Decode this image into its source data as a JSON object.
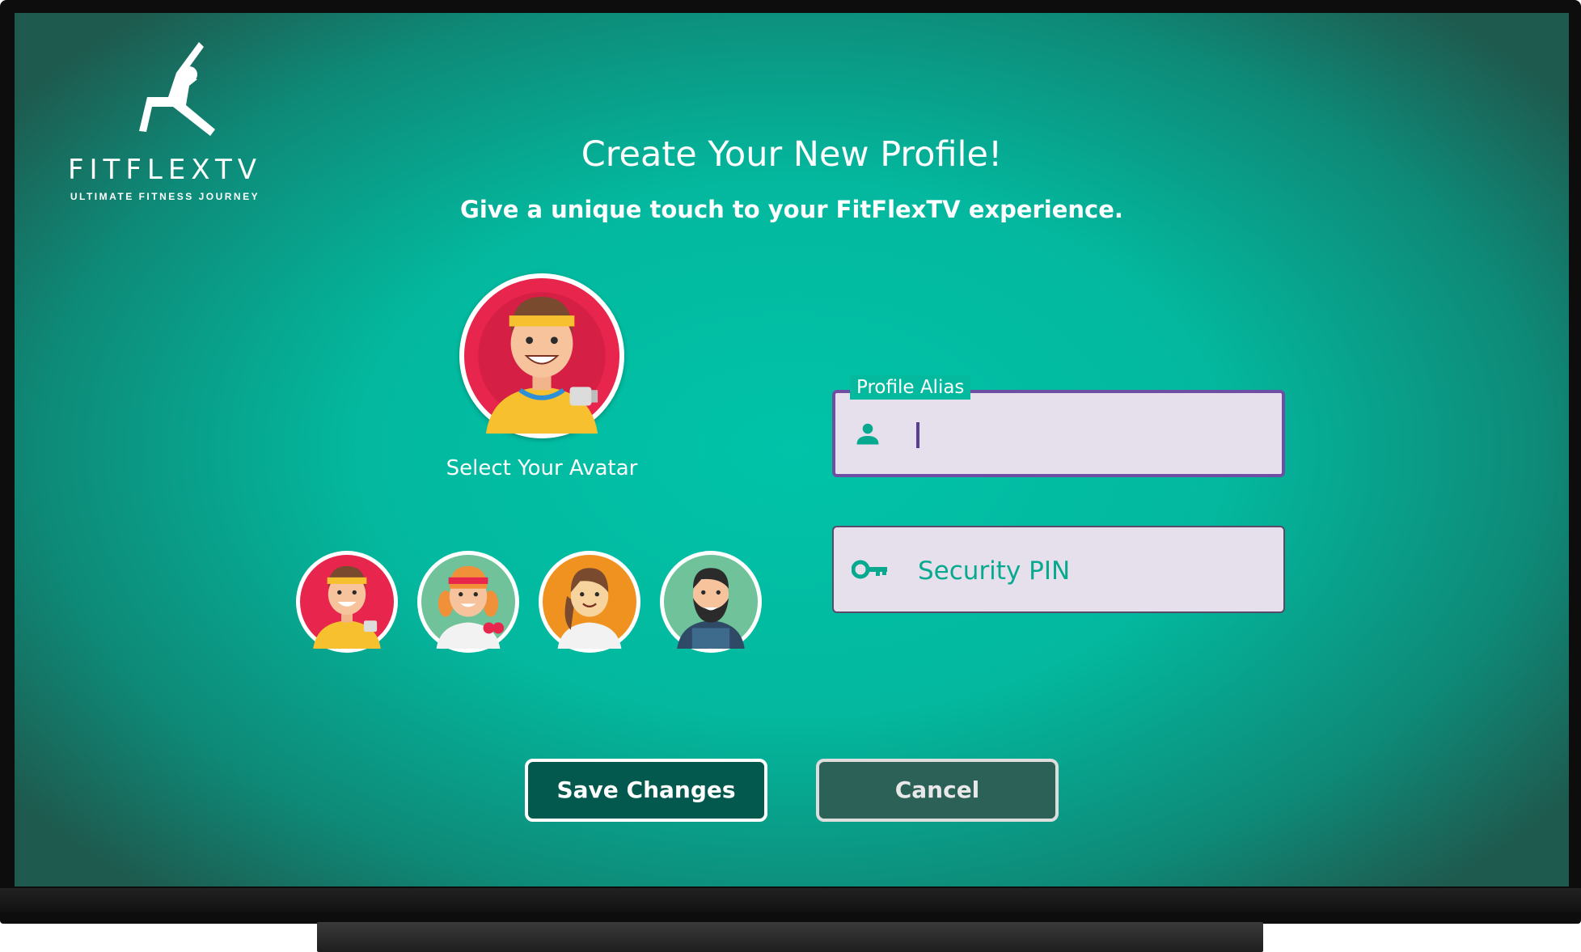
{
  "brand": {
    "name": "FITFLEXTV",
    "tagline": "ULTIMATE FITNESS JOURNEY",
    "icon": "yoga-figure-icon"
  },
  "header": {
    "title": "Create Your New Profile!",
    "subtitle": "Give a unique touch to your FitFlexTV experience."
  },
  "avatar": {
    "selected": "man-headband-dumbbell",
    "caption": "Select Your Avatar",
    "options": [
      {
        "id": "man-headband-dumbbell",
        "bg": "#e8254c"
      },
      {
        "id": "woman-headband-dumbbell",
        "bg": "#6fc29a"
      },
      {
        "id": "woman-ponytail",
        "bg": "#f0921f"
      },
      {
        "id": "bearded-man",
        "bg": "#6fc29a"
      }
    ]
  },
  "form": {
    "alias": {
      "label": "Profile Alias",
      "value": "",
      "icon": "person-icon"
    },
    "pin": {
      "placeholder": "Security PIN",
      "icon": "key-icon"
    }
  },
  "actions": {
    "save_label": "Save Changes",
    "cancel_label": "Cancel"
  },
  "colors": {
    "screen_accent": "#00c3a8",
    "field_bg": "#e6e0ec",
    "field_focus_border": "#6f4fa3",
    "save_bg": "#03594d",
    "cancel_bg": "#2c6158",
    "icon_teal": "#07a98f"
  }
}
